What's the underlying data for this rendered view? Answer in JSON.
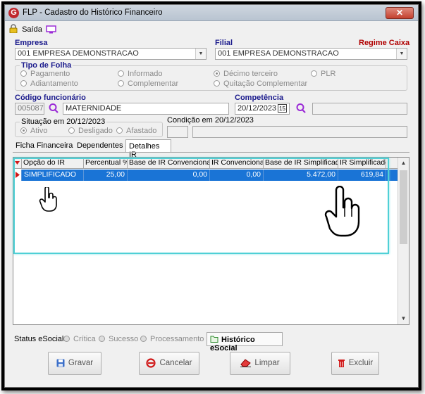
{
  "window": {
    "title": "FLP - Cadastro do Histórico Financeiro",
    "close": "✕",
    "logo": "G"
  },
  "toolbar": {
    "exit_label": "Saída"
  },
  "empresa": {
    "label": "Empresa",
    "value": "001 EMPRESA DEMONSTRACAO"
  },
  "filial": {
    "label": "Filial",
    "value": "001 EMPRESA DEMONSTRACAO",
    "regime": "Regime Caixa"
  },
  "tipo_folha": {
    "title": "Tipo de Folha",
    "options": [
      "Pagamento",
      "Informado",
      "Décimo terceiro",
      "PLR",
      "Adiantamento",
      "Complementar",
      "Quitação Complementar"
    ],
    "selected": "Décimo terceiro"
  },
  "funcionario": {
    "label": "Código funcionário",
    "code": "005087",
    "name": "MATERNIDADE"
  },
  "competencia": {
    "label": "Competência",
    "value": "20/12/2023",
    "cal": "15"
  },
  "situacao": {
    "title": "Situação em 20/12/2023",
    "options": [
      "Ativo",
      "Desligado",
      "Afastado"
    ],
    "selected": "Ativo"
  },
  "condicao": {
    "title": "Condição em 20/12/2023"
  },
  "tabs": [
    "Ficha Financeira",
    "Dependentes",
    "Detalhes IR"
  ],
  "grid": {
    "columns": [
      "Opção do IR",
      "Percentual %",
      "Base de IR Convencional",
      "IR Convencional",
      "Base de IR Simplificado",
      "IR Simplificado"
    ],
    "rows": [
      [
        "SIMPLIFICADO",
        "25,00",
        "0,00",
        "0,00",
        "5.472,00",
        "619,84"
      ]
    ]
  },
  "status": {
    "label": "Status eSocial:",
    "items": [
      "Crítica",
      "Sucesso",
      "Processamento"
    ],
    "historico": "Histórico eSocial"
  },
  "buttons": {
    "gravar": "Gravar",
    "cancelar": "Cancelar",
    "limpar": "Limpar",
    "excluir": "Excluir"
  },
  "colors": {
    "selection": "#1a74d6",
    "highlight": "#4fd0d6",
    "label_blue": "#1a1a8c",
    "label_red": "#b00000"
  }
}
